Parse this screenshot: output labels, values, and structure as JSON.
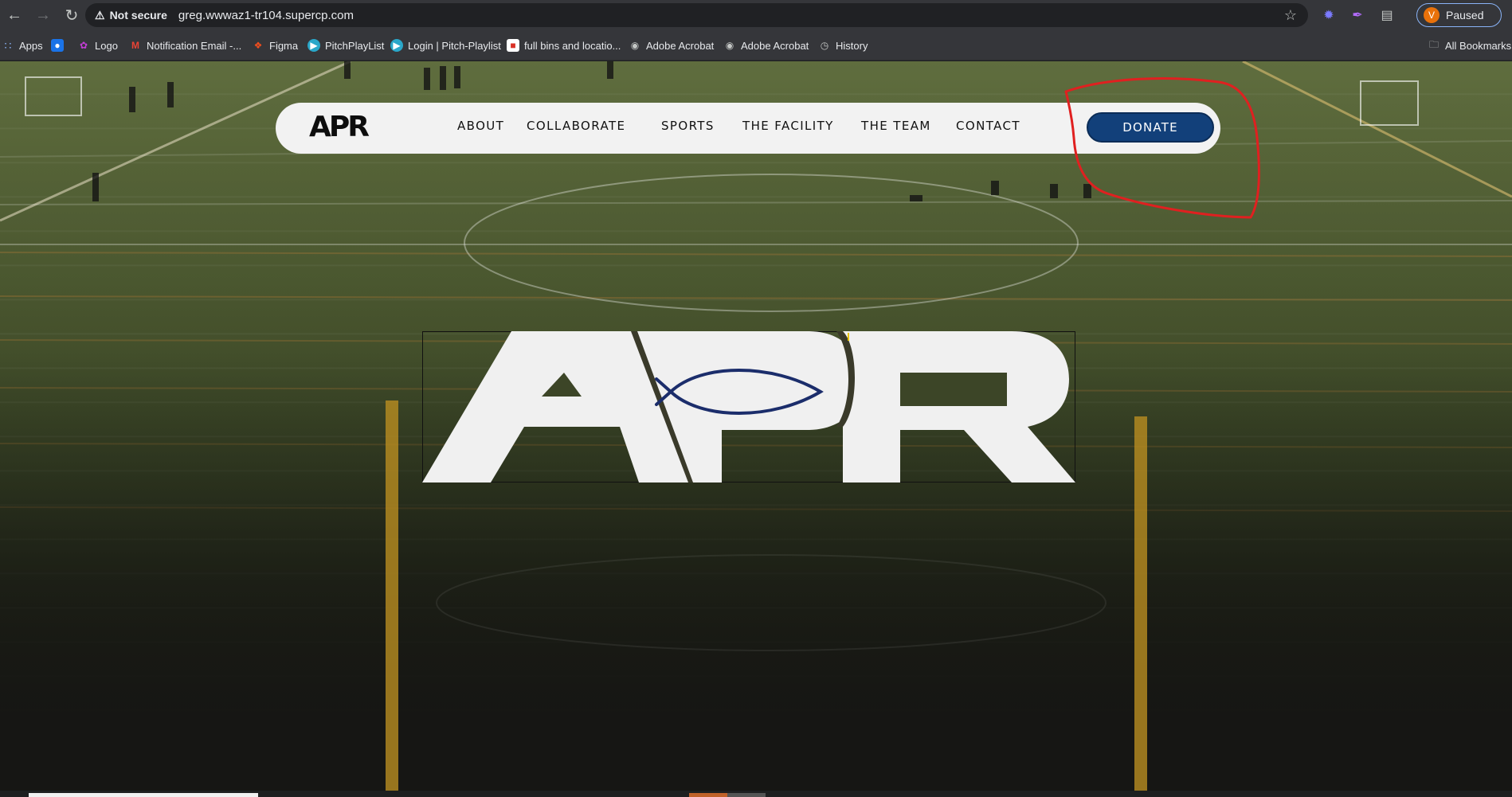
{
  "browser": {
    "security_label": "Not secure",
    "url": "greg.wwwaz1-tr104.supercp.com",
    "profile_initial": "V",
    "profile_status": "Paused"
  },
  "bookmarks": [
    {
      "label": "Apps",
      "icon": "apps-grid-icon"
    },
    {
      "label": "",
      "icon": "drop-icon"
    },
    {
      "label": "Logo",
      "icon": "logo-icon"
    },
    {
      "label": "Notification Email -...",
      "icon": "gmail-icon"
    },
    {
      "label": "Figma",
      "icon": "figma-icon"
    },
    {
      "label": "PitchPlayList",
      "icon": "pitchplaylist-icon"
    },
    {
      "label": "Login | Pitch-Playlist",
      "icon": "pitchplaylist-icon"
    },
    {
      "label": "full bins and locatio...",
      "icon": "bins-icon"
    },
    {
      "label": "Adobe Acrobat",
      "icon": "globe-icon"
    },
    {
      "label": "Adobe Acrobat",
      "icon": "globe-icon"
    },
    {
      "label": "History",
      "icon": "history-icon"
    }
  ],
  "all_bookmarks": "All Bookmarks",
  "site": {
    "logo_text": "APR",
    "nav": [
      "ABOUT",
      "COLLABORATE",
      "SPORTS",
      "THE FACILITY",
      "THE TEAM",
      "CONTACT"
    ],
    "donate_label": "DONATE",
    "hero_logo_text": "APR",
    "colors": {
      "brand_blue": "#12407a",
      "pill_bg": "#f2f2f2",
      "annotation_red": "#e02020"
    }
  }
}
